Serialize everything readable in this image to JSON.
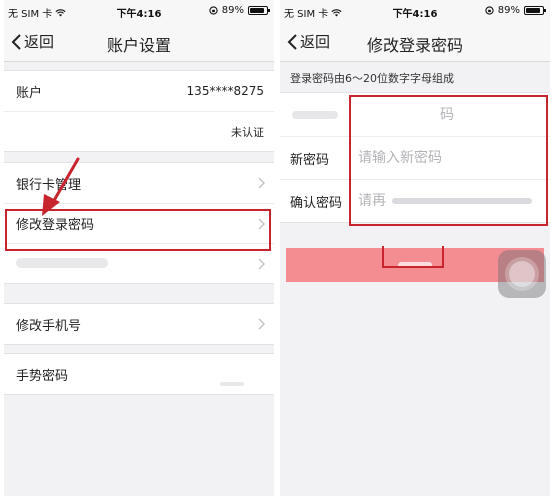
{
  "status_bar": {
    "carrier": "无 SIM 卡",
    "time": "下午4:16",
    "battery_text": "89%",
    "battery_level": 0.89
  },
  "left": {
    "nav": {
      "back_label": "返回",
      "title": "账户设置"
    },
    "account": {
      "label": "账户",
      "value": "135****8275",
      "status": "未认证"
    },
    "items": [
      {
        "label": "银行卡管理"
      },
      {
        "label": "修改登录密码"
      },
      {
        "label": "修改手机号"
      },
      {
        "label": "手势密码"
      }
    ]
  },
  "right": {
    "nav": {
      "back_label": "返回",
      "title": "修改登录密码"
    },
    "hint": "登录密码由6～20位数字字母组成",
    "fields": {
      "old_placeholder": "码",
      "new_label": "新密码",
      "new_placeholder": "请输入新密码",
      "confirm_label": "确认密码",
      "confirm_placeholder": "请再"
    }
  },
  "colors": {
    "highlight": "#c8242e",
    "submit": "#f48d92",
    "background": "#f2f2f4"
  },
  "icons": [
    "wifi-icon",
    "lock-icon",
    "battery-icon",
    "back-chevron-icon",
    "chevron-icon",
    "arrow-icon",
    "assistive-touch-icon"
  ]
}
